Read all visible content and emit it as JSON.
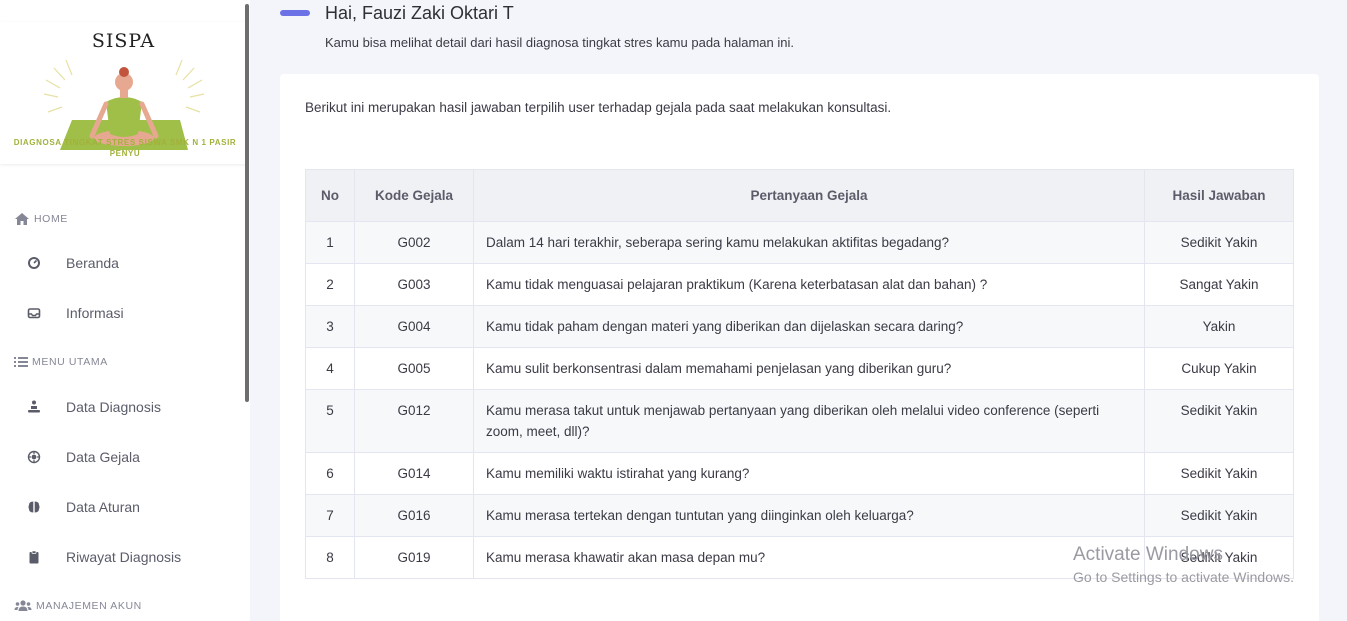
{
  "brand": {
    "title": "SISPA",
    "subtitle": "DIAGNOSA TINGKAT STRES SISWA SMK N 1 PASIR PENYU"
  },
  "sidebar": {
    "sections": [
      {
        "label": "HOME",
        "icon": "home-icon"
      },
      {
        "label": "MENU UTAMA",
        "icon": "list-icon"
      },
      {
        "label": "MANAJEMEN AKUN",
        "icon": "users-icon"
      }
    ],
    "items": [
      {
        "label": "Beranda",
        "icon": "dashboard-icon"
      },
      {
        "label": "Informasi",
        "icon": "inbox-icon"
      },
      {
        "label": "Data Diagnosis",
        "icon": "meditation-icon"
      },
      {
        "label": "Data Gejala",
        "icon": "virus-icon"
      },
      {
        "label": "Data Aturan",
        "icon": "brain-icon"
      },
      {
        "label": "Riwayat Diagnosis",
        "icon": "clipboard-icon"
      }
    ]
  },
  "header": {
    "greeting": "Hai, Fauzi Zaki Oktari T",
    "subtitle": "Kamu bisa melihat detail dari hasil diagnosa tingkat stres kamu pada halaman ini."
  },
  "card": {
    "description": "Berikut ini merupakan hasil jawaban terpilih user terhadap gejala pada saat melakukan konsultasi."
  },
  "table": {
    "columns": [
      "No",
      "Kode Gejala",
      "Pertanyaan Gejala",
      "Hasil Jawaban"
    ],
    "rows": [
      {
        "no": "1",
        "kode": "G002",
        "pertanyaan": "Dalam 14 hari terakhir, seberapa sering kamu melakukan aktifitas begadang?",
        "hasil": "Sedikit Yakin"
      },
      {
        "no": "2",
        "kode": "G003",
        "pertanyaan": "Kamu tidak menguasai pelajaran praktikum (Karena keterbatasan alat dan bahan) ?",
        "hasil": "Sangat Yakin"
      },
      {
        "no": "3",
        "kode": "G004",
        "pertanyaan": "Kamu tidak paham dengan materi yang diberikan dan dijelaskan secara daring?",
        "hasil": "Yakin"
      },
      {
        "no": "4",
        "kode": "G005",
        "pertanyaan": "Kamu sulit berkonsentrasi dalam memahami penjelasan yang diberikan guru?",
        "hasil": "Cukup Yakin"
      },
      {
        "no": "5",
        "kode": "G012",
        "pertanyaan": "Kamu merasa takut untuk menjawab pertanyaan yang diberikan oleh melalui video conference (seperti zoom, meet, dll)?",
        "hasil": "Sedikit Yakin"
      },
      {
        "no": "6",
        "kode": "G014",
        "pertanyaan": "Kamu memiliki waktu istirahat yang kurang?",
        "hasil": "Sedikit Yakin"
      },
      {
        "no": "7",
        "kode": "G016",
        "pertanyaan": "Kamu merasa tertekan dengan tuntutan yang diinginkan oleh keluarga?",
        "hasil": "Sedikit Yakin"
      },
      {
        "no": "8",
        "kode": "G019",
        "pertanyaan": "Kamu merasa khawatir akan masa depan mu?",
        "hasil": "Sedikit Yakin"
      }
    ]
  },
  "watermark": {
    "line1": "Activate Windows",
    "line2": "Go to Settings to activate Windows."
  }
}
